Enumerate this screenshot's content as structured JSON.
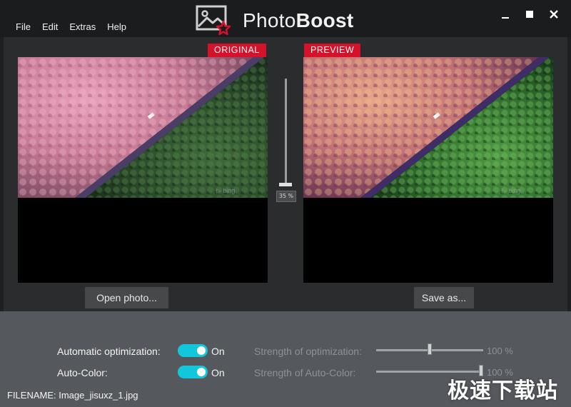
{
  "menu": {
    "items": [
      "File",
      "Edit",
      "Extras",
      "Help"
    ]
  },
  "app": {
    "title_light": "Photo",
    "title_bold": "Boost"
  },
  "window_controls": [
    "minimize-icon",
    "maximize-icon",
    "close-icon"
  ],
  "original": {
    "badge": "ORIGINAL"
  },
  "preview": {
    "badge": "PREVIEW"
  },
  "zoom": {
    "label": "35 %",
    "value_percent": 35
  },
  "buttons": {
    "open_photo": "Open photo...",
    "save_as": "Save as..."
  },
  "options": {
    "auto_opt": {
      "label": "Automatic optimization:",
      "state": "On",
      "enabled": true
    },
    "auto_color": {
      "label": "Auto-Color:",
      "state": "On",
      "enabled": true
    }
  },
  "strength": {
    "optimization": {
      "label": "Strength of optimization:",
      "value_text": "100 %",
      "value": 100
    },
    "auto_color": {
      "label": "Strength of Auto-Color:",
      "value_text": "100 %",
      "value": 100
    }
  },
  "status": {
    "filename": "FILENAME: Image_jisuxz_1.jpg"
  },
  "watermark": "极速下载站",
  "colors": {
    "accent": "#12c7dc",
    "badge": "#d6112a"
  }
}
